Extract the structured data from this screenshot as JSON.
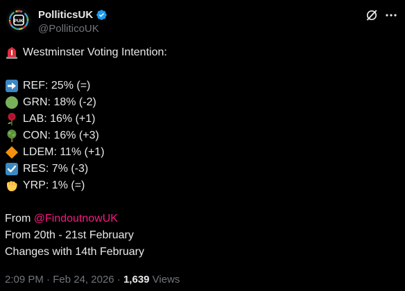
{
  "author": {
    "display_name": "PolliticsUK",
    "handle": "@PolliticoUK",
    "avatar_text": "PUK"
  },
  "post": {
    "headline": "Westminster Voting Intention:",
    "items": [
      {
        "icon": "right-arrow-icon",
        "text": "REF: 25% (=)"
      },
      {
        "icon": "green-circle-icon",
        "text": "GRN: 18% (-2)"
      },
      {
        "icon": "rose-icon",
        "text": "LAB: 16% (+1)"
      },
      {
        "icon": "tree-icon",
        "text": "CON: 16% (+3)"
      },
      {
        "icon": "orange-diamond-icon",
        "text": "LDEM: 11% (+1)"
      },
      {
        "icon": "check-box-icon",
        "text": "RES: 7% (-3)"
      },
      {
        "icon": "fist-icon",
        "text": "YRP: 1% (=)"
      }
    ],
    "source_prefix": "From ",
    "source_mention": "@FindoutnowUK",
    "dates_line": "From 20th - 21st February",
    "changes_line": "Changes with 14th February"
  },
  "meta": {
    "time": "2:09 PM",
    "separator1": " · ",
    "date": "Feb 24, 2026",
    "separator2": " · ",
    "views_count": "1,639",
    "views_label": " Views"
  },
  "colors": {
    "background": "#000000",
    "text": "#e7e9ea",
    "muted": "#71767b",
    "mention": "#f91880",
    "verified": "#1d9bf0"
  }
}
